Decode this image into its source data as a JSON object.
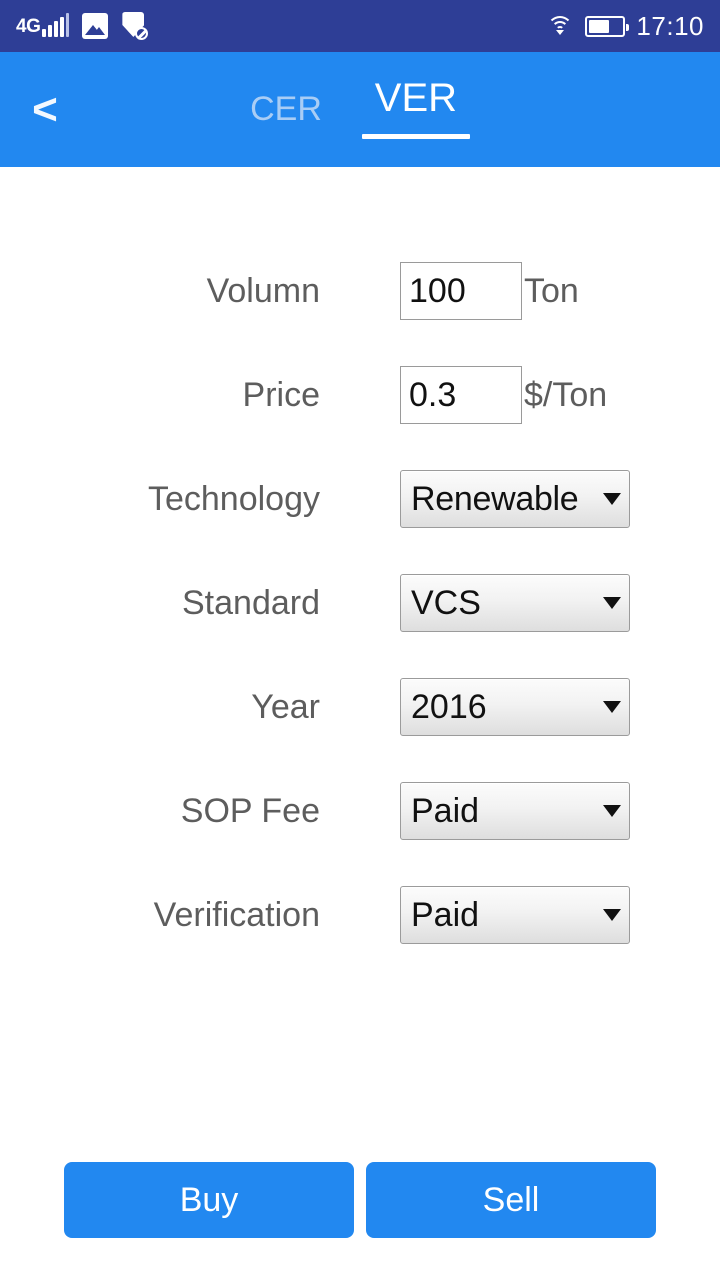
{
  "statusbar": {
    "network_label": "4G",
    "signal_icon": "signal-bars-icon",
    "gallery_icon": "gallery-icon",
    "shield_blocked_icon": "shield-blocked-icon",
    "wifi_icon": "wifi-icon",
    "battery_icon": "battery-icon",
    "battery_level_percent": 60,
    "time": "17:10"
  },
  "header": {
    "back_icon": "chevron-left-icon",
    "back_label": "<",
    "tabs": [
      {
        "label": "CER",
        "active": false
      },
      {
        "label": "VER",
        "active": true
      }
    ]
  },
  "form": {
    "rows": [
      {
        "label": "Volumn",
        "type": "input",
        "value": "100",
        "unit": "Ton"
      },
      {
        "label": "Price",
        "type": "input",
        "value": "0.3",
        "unit": "$/Ton"
      },
      {
        "label": "Technology",
        "type": "select",
        "value": "Renewable",
        "unit": ""
      },
      {
        "label": "Standard",
        "type": "select",
        "value": "VCS",
        "unit": ""
      },
      {
        "label": "Year",
        "type": "select",
        "value": "2016",
        "unit": ""
      },
      {
        "label": "SOP Fee",
        "type": "select",
        "value": "Paid",
        "unit": ""
      },
      {
        "label": "Verification",
        "type": "select",
        "value": "Paid",
        "unit": ""
      }
    ]
  },
  "footer": {
    "buy_label": "Buy",
    "sell_label": "Sell"
  },
  "colors": {
    "statusbar_bg": "#2e3e96",
    "header_bg": "#2288f0",
    "accent": "#2288f0",
    "tab_inactive": "#a9cdf5",
    "label_text": "#5d5d5d",
    "page_bg": "#ffffff"
  }
}
